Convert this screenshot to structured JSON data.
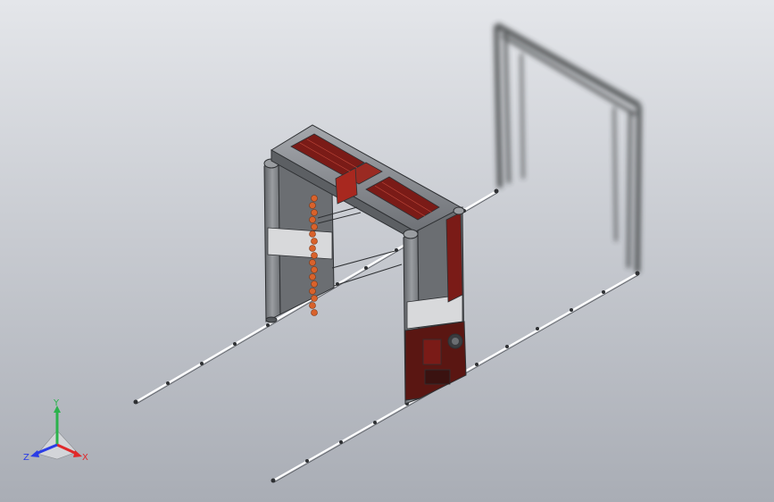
{
  "triad": {
    "x_label": "X",
    "y_label": "Y",
    "z_label": "Z",
    "x_color": "#e0282a",
    "y_color": "#2bb24c",
    "z_color": "#2a3ce6"
  },
  "model": {
    "frame_color": "#8c8f93",
    "panel_color": "#7a1b17",
    "brush_color": "#d9622b",
    "shadow_color": "#2e3033"
  }
}
